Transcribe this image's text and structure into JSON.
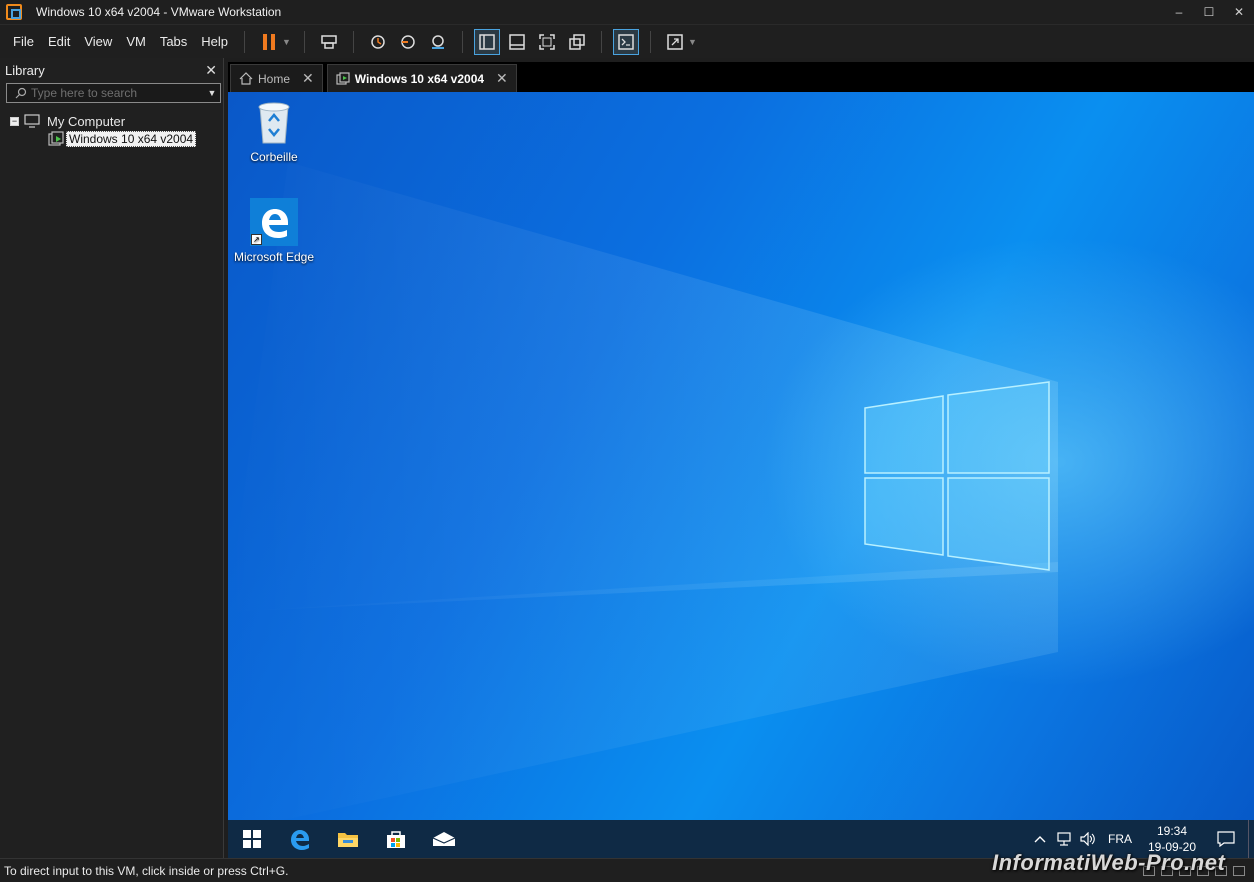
{
  "window": {
    "title": "Windows 10 x64 v2004 - VMware Workstation",
    "min": "–",
    "max": "☐",
    "close": "✕"
  },
  "menu": {
    "file": "File",
    "edit": "Edit",
    "view": "View",
    "vm": "VM",
    "tabs": "Tabs",
    "help": "Help"
  },
  "library": {
    "title": "Library",
    "close": "✕",
    "search_placeholder": "Type here to search",
    "tree": {
      "root_label": "My Computer",
      "root_toggle": "−",
      "vm_label": "Windows 10 x64 v2004"
    }
  },
  "tabs": {
    "home": "Home",
    "vm": "Windows 10 x64 v2004",
    "close": "✕"
  },
  "desktop": {
    "recycle_bin": "Corbeille",
    "edge": "Microsoft Edge",
    "tray_lang": "FRA",
    "clock_time": "19:34",
    "clock_date": "19-09-20",
    "accent": "#0b74e0"
  },
  "status": {
    "text": "To direct input to this VM, click inside or press Ctrl+G."
  },
  "watermark": "InformatiWeb-Pro.net"
}
